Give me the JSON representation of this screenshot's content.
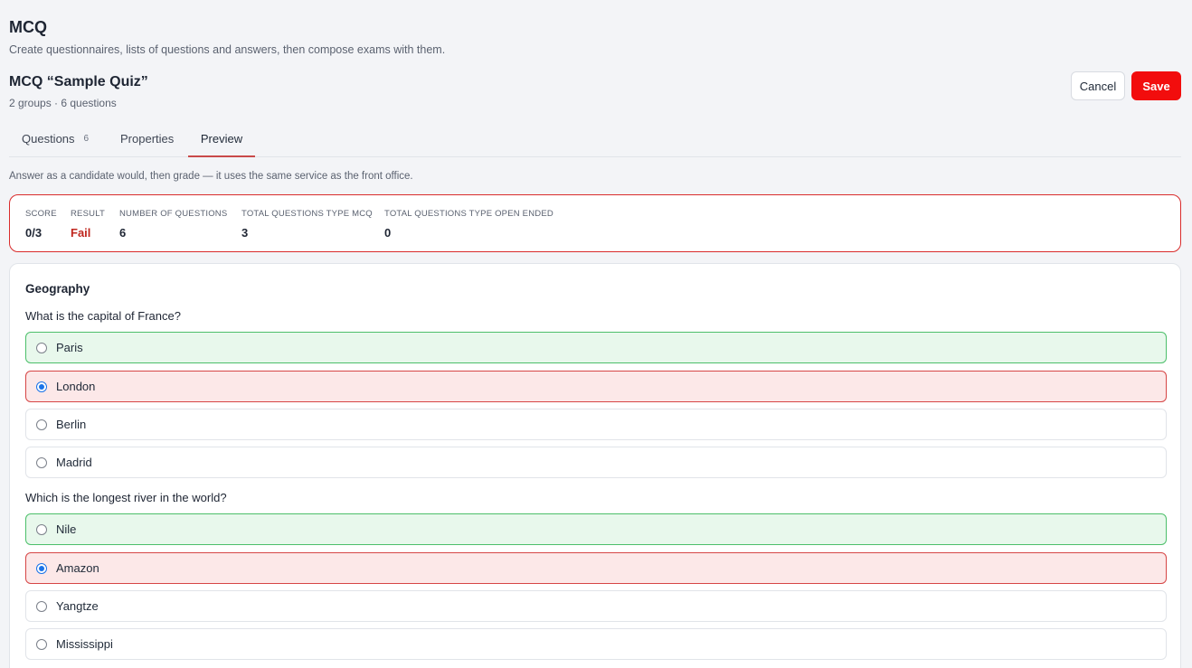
{
  "header": {
    "title": "MCQ",
    "subtitle": "Create questionnaires, lists of questions and answers, then compose exams with them.",
    "quiz_title": "MCQ “Sample Quiz”",
    "quiz_meta": "2 groups · 6 questions",
    "cancel_label": "Cancel",
    "save_label": "Save",
    "save_color": "#f20d0d"
  },
  "tabs": [
    {
      "label": "Questions",
      "count": "6"
    },
    {
      "label": "Properties"
    },
    {
      "label": "Preview",
      "active": true
    }
  ],
  "hint": "Answer as a candidate would, then grade — it uses the same service as the front office.",
  "stats": [
    {
      "label": "SCORE",
      "value": "0/3"
    },
    {
      "label": "RESULT",
      "value": "Fail",
      "color": "#c0271f"
    },
    {
      "label": "NUMBER OF QUESTIONS",
      "value": "6"
    },
    {
      "label": "TOTAL QUESTIONS TYPE MCQ",
      "value": "3"
    },
    {
      "label": "TOTAL QUESTIONS TYPE OPEN ENDED",
      "value": "0"
    }
  ],
  "group": {
    "title": "Geography",
    "questions": [
      {
        "text": "What is the capital of France?",
        "options": [
          {
            "label": "Paris",
            "state": "correct",
            "selected": false
          },
          {
            "label": "London",
            "state": "wrong",
            "selected": true
          },
          {
            "label": "Berlin",
            "state": "neutral",
            "selected": false
          },
          {
            "label": "Madrid",
            "state": "neutral",
            "selected": false
          }
        ]
      },
      {
        "text": "Which is the longest river in the world?",
        "options": [
          {
            "label": "Nile",
            "state": "correct",
            "selected": false
          },
          {
            "label": "Amazon",
            "state": "wrong",
            "selected": true
          },
          {
            "label": "Yangtze",
            "state": "neutral",
            "selected": false
          },
          {
            "label": "Mississippi",
            "state": "neutral",
            "selected": false
          }
        ]
      }
    ]
  }
}
